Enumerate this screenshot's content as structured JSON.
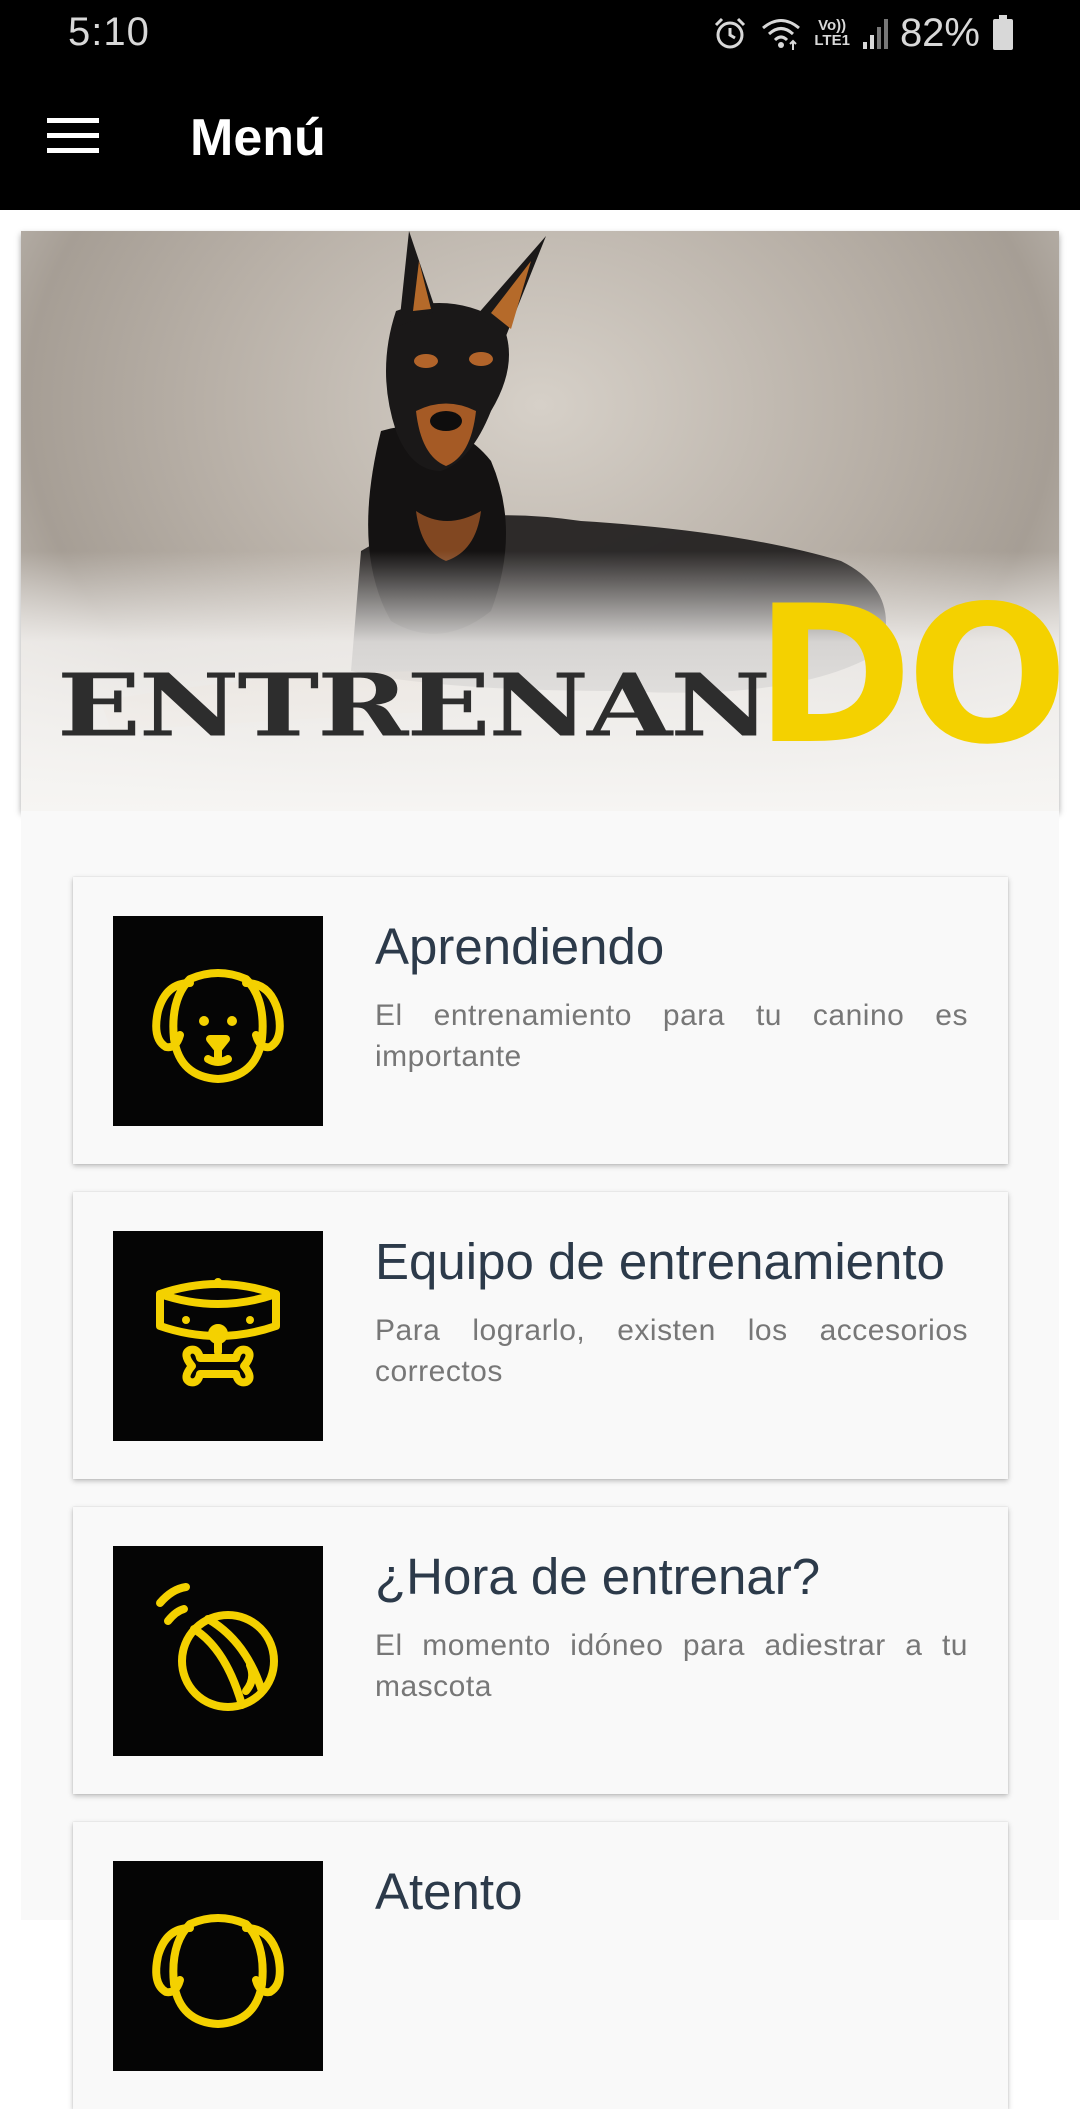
{
  "status_bar": {
    "time": "5:10",
    "network_label_top": "Vo))",
    "network_label_bottom": "LTE1",
    "battery": "82%",
    "icons": [
      "alarm-icon",
      "wifi-icon",
      "signal-icon",
      "battery-icon"
    ]
  },
  "app_bar": {
    "title": "Menú",
    "menu_icon": "hamburger-icon"
  },
  "banner": {
    "brand_part1": "ENTRENAN",
    "brand_part2": "DOG",
    "brand_colors": {
      "part1": "#2d2d2d",
      "part2": "#f4d100"
    }
  },
  "colors": {
    "accent": "#f4d100",
    "title_text": "#2c3a4a",
    "description_text": "#777777",
    "bars": "#000000"
  },
  "cards": [
    {
      "title": "Aprendiendo",
      "description": "El entrenamiento para tu canino es importante",
      "icon": "dog-face-icon"
    },
    {
      "title": "Equipo de entrenamiento",
      "description": "Para lograrlo, existen los accesorios correctos",
      "icon": "dog-collar-bone-icon"
    },
    {
      "title": "¿Hora de entrenar?",
      "description": "El momento idóneo para adiestrar a tu mascota",
      "icon": "ball-icon"
    },
    {
      "title": "Atento",
      "description": "",
      "icon": "dog-face-icon"
    }
  ]
}
